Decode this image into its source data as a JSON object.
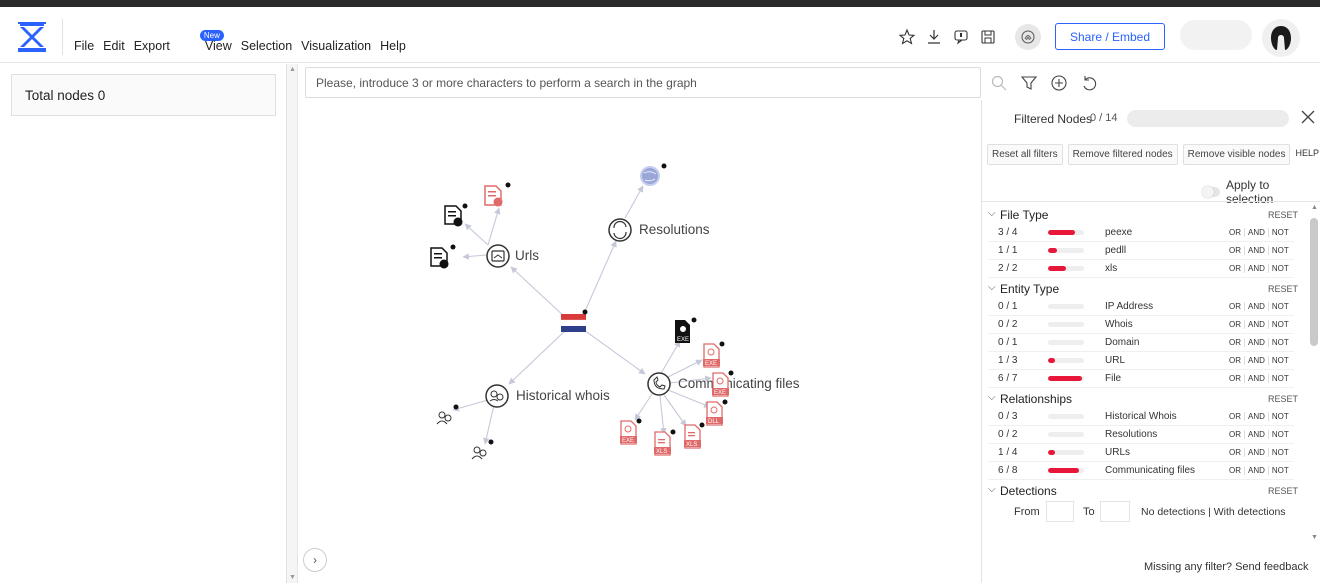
{
  "menu": {
    "items": [
      "File",
      "Edit",
      "Export",
      "View",
      "Selection",
      "Visualization",
      "Help"
    ],
    "new_badge": "New"
  },
  "toolbar": {
    "icons": [
      "star-icon",
      "download-icon",
      "comment-icon",
      "save-icon",
      "fingerprint-icon"
    ],
    "share_label": "Share / Embed"
  },
  "left": {
    "total_nodes": "Total nodes 0"
  },
  "search": {
    "placeholder": "Please, introduce 3 or more characters to perform a search in the graph"
  },
  "graph": {
    "labels": {
      "urls": "Urls",
      "resolutions": "Resolutions",
      "historical_whois": "Historical whois",
      "communicating_files": "Communicating files"
    },
    "file_badges": [
      "EXE",
      "EXE",
      "EXE",
      "DLL",
      "EXE",
      "XLS",
      "XLS"
    ]
  },
  "filter": {
    "title": "Filtered Nodes",
    "count": "0 / 14",
    "buttons": [
      "Reset all filters",
      "Remove filtered nodes",
      "Remove visible nodes"
    ],
    "help": "HELP",
    "apply_to_selection": "Apply to selection",
    "reset": "RESET",
    "ops": [
      "OR",
      "AND",
      "NOT"
    ],
    "sections": [
      {
        "title": "File Type",
        "rows": [
          {
            "count": "3 / 4",
            "fraction": 0.75,
            "name": "peexe"
          },
          {
            "count": "1 / 1",
            "fraction": 0.25,
            "name": "pedll"
          },
          {
            "count": "2 / 2",
            "fraction": 0.5,
            "name": "xls"
          }
        ]
      },
      {
        "title": "Entity Type",
        "rows": [
          {
            "count": "0 / 1",
            "fraction": 0,
            "name": "IP Address"
          },
          {
            "count": "0 / 2",
            "fraction": 0,
            "name": "Whois"
          },
          {
            "count": "0 / 1",
            "fraction": 0,
            "name": "Domain"
          },
          {
            "count": "1 / 3",
            "fraction": 0.2,
            "name": "URL"
          },
          {
            "count": "6 / 7",
            "fraction": 0.95,
            "name": "File"
          }
        ]
      },
      {
        "title": "Relationships",
        "rows": [
          {
            "count": "0 / 3",
            "fraction": 0,
            "name": "Historical Whois"
          },
          {
            "count": "0 / 2",
            "fraction": 0,
            "name": "Resolutions"
          },
          {
            "count": "1 / 4",
            "fraction": 0.2,
            "name": "URLs"
          },
          {
            "count": "6 / 8",
            "fraction": 0.85,
            "name": "Communicating files"
          }
        ]
      }
    ],
    "detections": {
      "title": "Detections",
      "from": "From",
      "to": "To",
      "text": "No detections | With detections"
    },
    "feedback": "Missing any filter? Send feedback"
  },
  "colors": {
    "accent": "#2962ff",
    "filter_red": "#e8173a",
    "file_red": "#e06a6a",
    "edge": "#c5c8d8"
  }
}
